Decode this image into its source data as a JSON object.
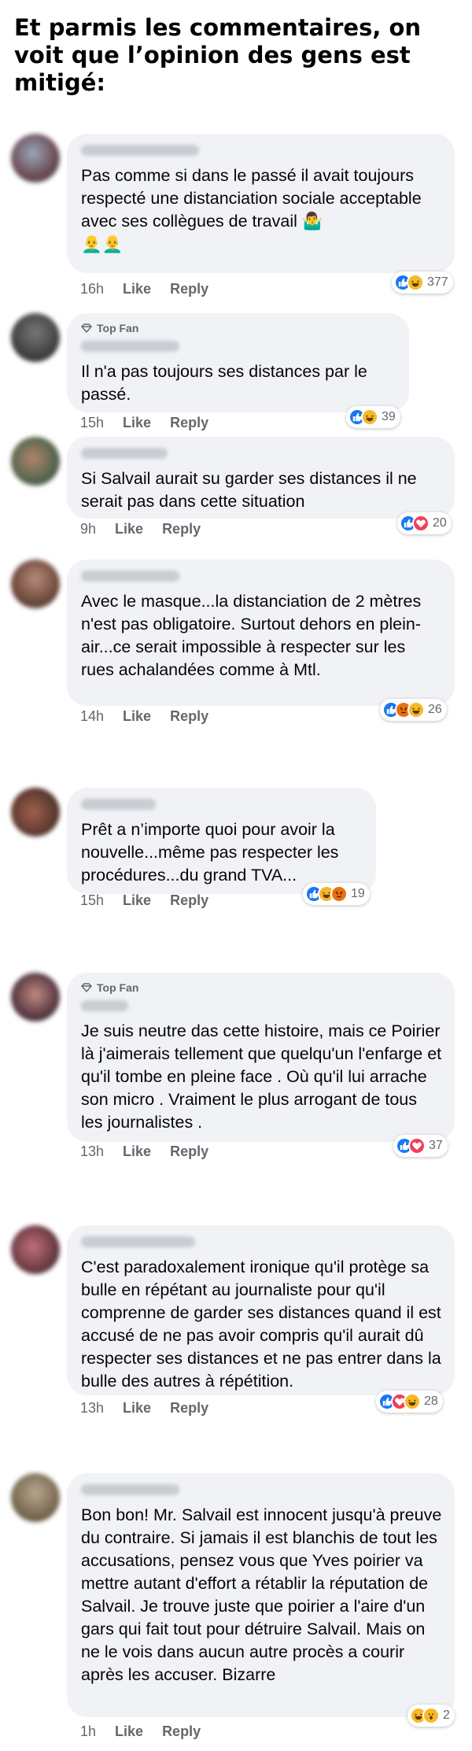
{
  "headline": "Et parmis les commentaires, on voit que l’opinion des gens est mitigé:",
  "badge": {
    "top_fan": "Top Fan"
  },
  "actions": {
    "like": "Like",
    "reply": "Reply"
  },
  "comments": [
    {
      "top_fan": false,
      "text": "Pas comme si dans le passé il avait toujours respecté une distanciation sociale acceptable avec ses collègues de travail 🤷‍♂️\n👨‍🦲👨‍🦲",
      "time": "16h",
      "reactions": [
        "like",
        "haha"
      ],
      "count": "377"
    },
    {
      "top_fan": true,
      "text": "Il n'a pas toujours ses distances par le passé.",
      "time": "15h",
      "reactions": [
        "like",
        "haha"
      ],
      "count": "39"
    },
    {
      "top_fan": false,
      "text": "Si Salvail aurait su garder ses distances il ne serait pas dans cette situation",
      "time": "9h",
      "reactions": [
        "like",
        "love"
      ],
      "count": "20"
    },
    {
      "top_fan": false,
      "text": "Avec le masque...la distanciation de 2 mètres n'est pas obligatoire. Surtout dehors en plein-air...ce serait impossible à respecter sur les rues achalandées comme à Mtl.",
      "time": "14h",
      "reactions": [
        "like",
        "angry",
        "haha"
      ],
      "count": "26"
    },
    {
      "top_fan": false,
      "text": "Prêt a n’importe quoi pour avoir la nouvelle...même pas respecter les procédures...du grand TVA...",
      "time": "15h",
      "reactions": [
        "like",
        "haha",
        "angry"
      ],
      "count": "19"
    },
    {
      "top_fan": true,
      "text": "Je suis neutre das cette histoire,  mais ce Poirier là j'aimerais tellement que quelqu'un l'enfarge et qu'il tombe en pleine face . Où qu'il lui arrache son micro . Vraiment le plus arrogant de tous les journalistes .",
      "time": "13h",
      "reactions": [
        "like",
        "love"
      ],
      "count": "37"
    },
    {
      "top_fan": false,
      "text": "C'est paradoxalement ironique qu'il protège sa bulle en répétant au journaliste pour qu'il comprenne  de garder ses distances quand il est accusé de ne pas avoir  compris qu'il aurait dû respecter ses distances et ne pas entrer dans la bulle des autres à répétition.",
      "time": "13h",
      "reactions": [
        "like",
        "love",
        "haha"
      ],
      "count": "28"
    },
    {
      "top_fan": false,
      "text": "Bon bon! Mr. Salvail  est innocent jusqu'à preuve du contraire. Si jamais il est blanchis de tout les accusations, pensez vous que Yves poirier va mettre autant d'effort a rétablir la réputation de Salvail. Je trouve juste que poirier a l'aire d'un gars qui fait tout pour détruire Salvail. Mais on ne le vois dans aucun autre procès a courir après les accuser. Bizarre",
      "time": "1h",
      "reactions": [
        "haha",
        "wow"
      ],
      "count": "2"
    }
  ]
}
